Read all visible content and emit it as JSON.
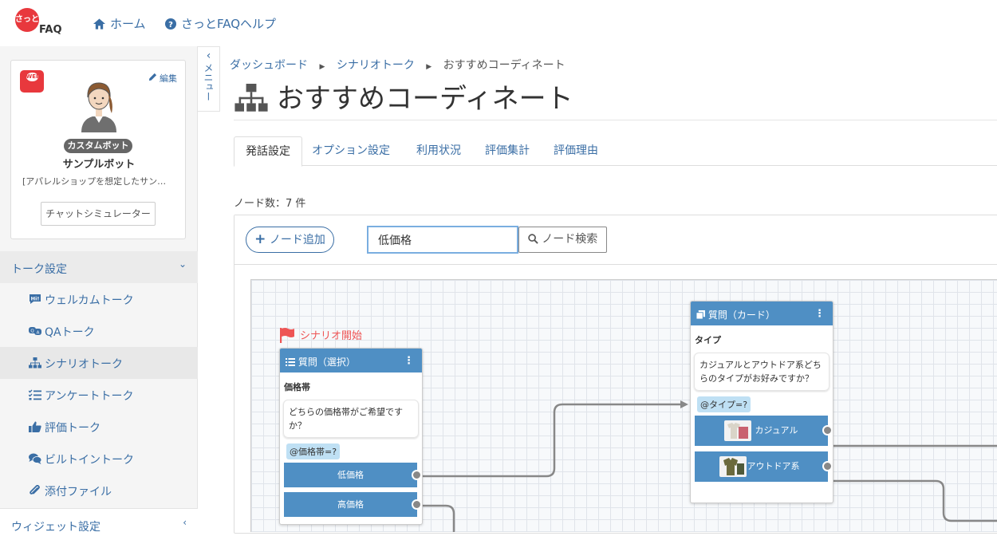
{
  "header": {
    "logo_text": "FAQ",
    "logo_mark": "さっと",
    "nav": [
      {
        "label": "ホーム",
        "icon": "home-icon"
      },
      {
        "label": "さっとFAQヘルプ",
        "icon": "help-circle-icon"
      }
    ]
  },
  "sidebar": {
    "bot": {
      "badge": "WEB",
      "edit_label": "編集",
      "type_label": "カスタムボット",
      "name": "サンプルボット",
      "description": "[アパレルショップを想定したサン…",
      "simulator_label": "チャットシミュレーター"
    },
    "section_talk": "トーク設定",
    "items": [
      {
        "label": "ウェルカムトーク",
        "icon": "hi-bubble-icon"
      },
      {
        "label": "QAトーク",
        "icon": "qa-bubble-icon"
      },
      {
        "label": "シナリオトーク",
        "icon": "sitemap-icon"
      },
      {
        "label": "アンケートトーク",
        "icon": "checklist-icon"
      },
      {
        "label": "評価トーク",
        "icon": "thumbs-up-icon"
      },
      {
        "label": "ビルトイントーク",
        "icon": "comments-icon"
      },
      {
        "label": "添付ファイル",
        "icon": "paperclip-icon"
      }
    ],
    "section_widget": "ウィジェット設定",
    "collapse_label": "メニュー"
  },
  "breadcrumb": [
    "ダッシュボード",
    "シナリオトーク",
    "おすすめコーディネート"
  ],
  "page_title": "おすすめコーディネート",
  "tabs": [
    "発話設定",
    "オプション設定",
    "利用状況",
    "評価集計",
    "評価理由"
  ],
  "node_count": "ノード数：7 件",
  "toolbar": {
    "add_label": "ノード追加",
    "search_value": "低価格",
    "search_label": "ノード検索"
  },
  "canvas": {
    "start_label": "シナリオ開始",
    "nodes": [
      {
        "header": "質問（選択）",
        "label": "価格帯",
        "message": "どちらの価格帯がご希望ですか？",
        "variable": "@価格帯=?",
        "choices": [
          "低価格",
          "高価格"
        ]
      },
      {
        "header": "質問（カード）",
        "label": "タイプ",
        "message": "カジュアルとアウトドア系どちらのタイプがお好みですか？",
        "variable": "@タイプ=?",
        "choices": [
          "カジュアル",
          "アウトドア系"
        ]
      }
    ]
  },
  "colors": {
    "accent": "#3a6ea5",
    "node_header": "#4f8fc4",
    "brand_red": "#e8383d",
    "variable_tag": "#bfe0f4"
  }
}
